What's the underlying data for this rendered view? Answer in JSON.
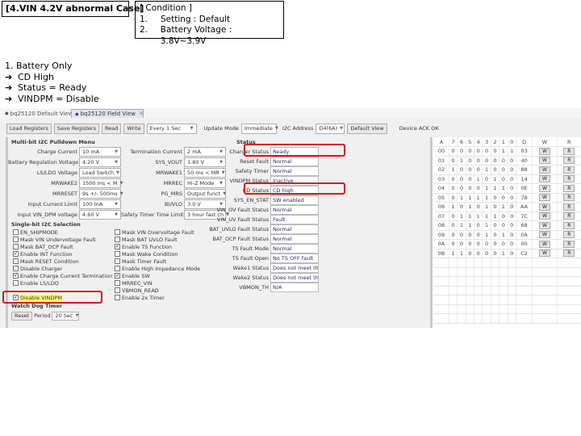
{
  "case_title": "[4.VIN 4.2V abnormal Case]",
  "condition": {
    "heading": "[ Condition ]",
    "items": [
      {
        "num": "1.",
        "text": "Setting : Default"
      },
      {
        "num": "2.",
        "text": "Battery Voltage : 3.8V~3.9V"
      }
    ]
  },
  "notes": {
    "line1": "1. Battery Only",
    "arrows": [
      "CD High",
      "Status = Ready",
      "VINDPM = Disable"
    ],
    "arrow_glyph": "➔"
  },
  "tabs": [
    {
      "label": "bq25120 Default View",
      "active": false
    },
    {
      "label": "bq25120 Field View",
      "active": true,
      "close": "✕"
    }
  ],
  "toolbar": {
    "load": "Load Registers",
    "save": "Save Registers",
    "read": "Read",
    "write": "Write",
    "interval": "Every 1 Sec",
    "update_mode_label": "Update Mode",
    "update_mode": "Immediate",
    "i2c_label": "I2C Address",
    "i2c_value": "D4(6A)",
    "default_view": "Default View",
    "ack": "Device ACK OK"
  },
  "multibit": {
    "title": "Multi-bit I2C Pulldown Menu",
    "left": [
      {
        "label": "Charge Current",
        "value": "10 mA"
      },
      {
        "label": "Battery Regulation Voltage",
        "value": "4.20 V"
      },
      {
        "label": "LS/LDO Voltage",
        "value": "Load Switch"
      },
      {
        "label": "MRWAKE2",
        "value": "1500 ms < M"
      },
      {
        "label": "MRRESET",
        "value": "9s +/- 500ms"
      },
      {
        "label": "Input Current Limit",
        "value": "100 mA"
      },
      {
        "label": "Input VIN_DPM voltage",
        "value": "4.60 V"
      }
    ],
    "right": [
      {
        "label": "Termination Current",
        "value": "2 mA"
      },
      {
        "label": "SYS_VOUT",
        "value": "1.80 V"
      },
      {
        "label": "MRWAKE1",
        "value": "50 ms < MR"
      },
      {
        "label": "MRREC",
        "value": "Hi-Z Mode"
      },
      {
        "label": "PG_MRS",
        "value": "Output funct"
      },
      {
        "label": "BUVLO",
        "value": "3.0 V"
      },
      {
        "label": "Safety Timer Time Limit",
        "value": "3 hour fast ch"
      }
    ]
  },
  "singlebit": {
    "title": "Single-bit I2C Selection",
    "left": [
      {
        "label": "EN_SHIPMODE",
        "checked": false
      },
      {
        "label": "Mask VIN Undervoltage Fault",
        "checked": false
      },
      {
        "label": "Mask BAT_OCP Fault",
        "checked": false
      },
      {
        "label": "Enable INT Function",
        "checked": true
      },
      {
        "label": "Mask RESET Condition",
        "checked": false
      },
      {
        "label": "Disable Charger",
        "checked": false
      },
      {
        "label": "Enable Charge Current Termination",
        "checked": true
      },
      {
        "label": "Enable LS/LDO",
        "checked": false
      },
      {
        "label": "Disable VINDPM",
        "checked": true,
        "highlight": true
      }
    ],
    "right": [
      {
        "label": "Mask VIN Overvoltage Fault",
        "checked": false
      },
      {
        "label": "Mask BAT UVLO Fault",
        "checked": false
      },
      {
        "label": "Enable TS Function",
        "checked": true
      },
      {
        "label": "Mask Wake Condition",
        "checked": false
      },
      {
        "label": "Mask Timer Fault",
        "checked": false
      },
      {
        "label": "Enable High Impedance Mode",
        "checked": false
      },
      {
        "label": "Enable SW",
        "checked": true
      },
      {
        "label": "MRREC_VIN",
        "checked": false
      },
      {
        "label": "VBMON_READ",
        "checked": false
      },
      {
        "label": "Enable 2x Timer",
        "checked": false
      }
    ],
    "check_glyph": "✓"
  },
  "watchdog": {
    "title": "Watch Dog Timer",
    "reset": "Reset",
    "period_label": "Period",
    "period_value": "20 Sec"
  },
  "status": {
    "title": "Status",
    "rows": [
      {
        "label": "Charger Status",
        "value": "Ready",
        "highlight": true
      },
      {
        "label": "Reset Fault",
        "value": "Normal"
      },
      {
        "label": "Safety Timer",
        "value": "Normal"
      },
      {
        "label": "VINDPM Status",
        "value": "Inactive"
      },
      {
        "label": "CD Status",
        "value": "CD high",
        "highlight": true
      },
      {
        "label": "SYS_EN_STAT",
        "value": "SW enabled"
      },
      {
        "label": "VIN_OV Fault Status",
        "value": "Normal"
      },
      {
        "label": "VIN_UV Fault Status",
        "value": "Fault"
      },
      {
        "label": "BAT_UVLO Fault Status",
        "value": "Normal"
      },
      {
        "label": "BAT_OCP Fault Status",
        "value": "Normal"
      },
      {
        "label": "TS Fault Mode",
        "value": "Normal"
      },
      {
        "label": "TS Fault Open",
        "value": "No TS OFF fault"
      },
      {
        "label": "Wake1 Status",
        "value": "Does not meet the"
      },
      {
        "label": "Wake2 Status",
        "value": "Does not meet the"
      },
      {
        "label": "VBMON_TH",
        "value": "N/A"
      }
    ]
  },
  "registers": {
    "headers": [
      "A",
      "7",
      "6",
      "5",
      "4",
      "3",
      "2",
      "1",
      "0",
      "D",
      "W",
      "R"
    ],
    "rows": [
      {
        "addr": "00",
        "bits": [
          "0",
          "0",
          "0",
          "0",
          "0",
          "0",
          "1",
          "1"
        ],
        "data": "03"
      },
      {
        "addr": "01",
        "bits": [
          "0",
          "1",
          "0",
          "0",
          "0",
          "0",
          "0",
          "0"
        ],
        "data": "40"
      },
      {
        "addr": "02",
        "bits": [
          "1",
          "0",
          "0",
          "0",
          "1",
          "0",
          "0",
          "0"
        ],
        "data": "88"
      },
      {
        "addr": "03",
        "bits": [
          "0",
          "0",
          "0",
          "1",
          "0",
          "1",
          "0",
          "0"
        ],
        "data": "14"
      },
      {
        "addr": "04",
        "bits": [
          "0",
          "0",
          "0",
          "0",
          "1",
          "1",
          "1",
          "0"
        ],
        "data": "0E"
      },
      {
        "addr": "05",
        "bits": [
          "0",
          "1",
          "1",
          "1",
          "1",
          "0",
          "0",
          "0"
        ],
        "data": "78"
      },
      {
        "addr": "06",
        "bits": [
          "1",
          "0",
          "1",
          "0",
          "1",
          "0",
          "1",
          "0"
        ],
        "data": "AA"
      },
      {
        "addr": "07",
        "bits": [
          "0",
          "1",
          "1",
          "1",
          "1",
          "1",
          "0",
          "0"
        ],
        "data": "7C"
      },
      {
        "addr": "08",
        "bits": [
          "0",
          "1",
          "1",
          "0",
          "1",
          "0",
          "0",
          "0"
        ],
        "data": "68"
      },
      {
        "addr": "09",
        "bits": [
          "0",
          "0",
          "0",
          "0",
          "1",
          "0",
          "1",
          "0"
        ],
        "data": "0A"
      },
      {
        "addr": "0A",
        "bits": [
          "0",
          "0",
          "0",
          "0",
          "0",
          "0",
          "0",
          "0"
        ],
        "data": "00"
      },
      {
        "addr": "0B",
        "bits": [
          "1",
          "1",
          "0",
          "0",
          "0",
          "0",
          "1",
          "0"
        ],
        "data": "C2"
      }
    ],
    "write_label": "W",
    "read_label": "R"
  },
  "colors": {
    "highlight_red": "#d9161e",
    "highlight_yellow": "#ffff66"
  }
}
